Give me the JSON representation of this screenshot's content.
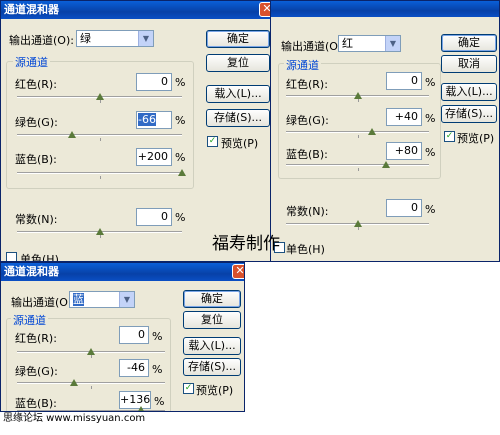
{
  "watermark": "福寿制作",
  "footer": "思缘论坛  www.missyuan.com",
  "dialog1": {
    "title": "通道混和器",
    "output_label": "输出通道(O):",
    "output_value": "绿",
    "group_label": "源通道",
    "red_label": "红色(R):",
    "red_value": "0",
    "red_level": 0,
    "green_label": "绿色(G):",
    "green_value": "-66",
    "green_level": -66,
    "blue_label": "蓝色(B):",
    "blue_value": "+200",
    "blue_level": 200,
    "const_label": "常数(N):",
    "const_value": "0",
    "const_level": 0,
    "pct": "%",
    "ok": "确定",
    "reset": "复位",
    "load": "载入(L)...",
    "save": "存储(S)...",
    "preview": "预览(P)",
    "mono": "单色(H)"
  },
  "dialog2": {
    "output_label": "输出通道(O):",
    "output_value": "红",
    "group_label": "源通道",
    "red_label": "红色(R):",
    "red_value": "0",
    "red_level": 0,
    "green_label": "绿色(G):",
    "green_value": "+40",
    "green_level": 40,
    "blue_label": "蓝色(B):",
    "blue_value": "+80",
    "blue_level": 80,
    "const_label": "常数(N):",
    "const_value": "0",
    "const_level": 0,
    "pct": "%",
    "ok": "确定",
    "cancel": "取消",
    "load": "载入(L)...",
    "save": "存储(S)...",
    "preview": "预览(P)",
    "mono": "单色(H)"
  },
  "dialog3": {
    "title": "通道混和器",
    "output_label": "输出通道(O):",
    "output_value": "蓝",
    "group_label": "源通道",
    "red_label": "红色(R):",
    "red_value": "0",
    "red_level": 0,
    "green_label": "绿色(G):",
    "green_value": "-46",
    "green_level": -46,
    "blue_label": "蓝色(B):",
    "blue_value": "+136",
    "blue_level": 136,
    "pct": "%",
    "ok": "确定",
    "reset": "复位",
    "load": "载入(L)...",
    "save": "存储(S)...",
    "preview": "预览(P)"
  },
  "icons": {
    "close": "close-icon",
    "dropdown": "chevron-down-icon",
    "check": "checkmark-icon"
  }
}
